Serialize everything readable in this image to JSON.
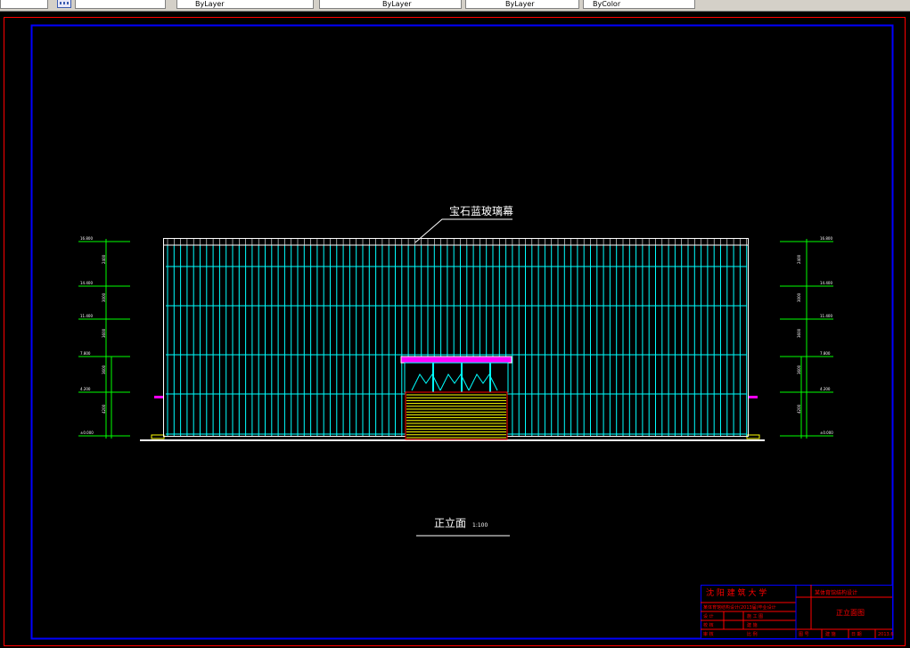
{
  "toolbar": {
    "cells": [
      "ByLayer",
      "ByLayer",
      "ByLayer",
      "ByColor"
    ]
  },
  "drawing": {
    "callout_label": "宝石蓝玻璃幕",
    "view_title": "正立面",
    "view_scale": "1:100",
    "left_elev_labels": [
      "16.800",
      "14.400",
      "11.400",
      "7.800",
      "4.200",
      "±0.000"
    ],
    "left_dim_labels": [
      "2400",
      "3000",
      "3600",
      "3600",
      "4200"
    ],
    "right_elev_labels": [
      "16.800",
      "14.400",
      "11.400",
      "7.800",
      "4.200",
      "±0.000"
    ],
    "right_dim_labels": [
      "2400",
      "3000",
      "3600",
      "3600",
      "4200"
    ]
  },
  "title_block": {
    "school": "沈 阳 建 筑 大 学",
    "project": "某体育馆结构设计",
    "sheet_title": "正立面图",
    "row1": "某体育馆结构设计(2013届)毕业设计",
    "row2_label": "设 计",
    "row2_value": "施 工 图",
    "row3_label": "校 核",
    "row3_value": "建 施",
    "row4_label": "审 核",
    "row4_value": "比 例",
    "bottom_cells": [
      "图 号",
      "建 施",
      "日 期",
      "2013.6"
    ]
  },
  "colors": {
    "background": "#000000",
    "frame_outer": "#ff0000",
    "frame_inner": "#0000ff",
    "curtain_wall": "#00ffff",
    "dimension": "#00ff00",
    "door": "#ffff00",
    "canopy": "#ff00ff",
    "text": "#ffffff"
  }
}
